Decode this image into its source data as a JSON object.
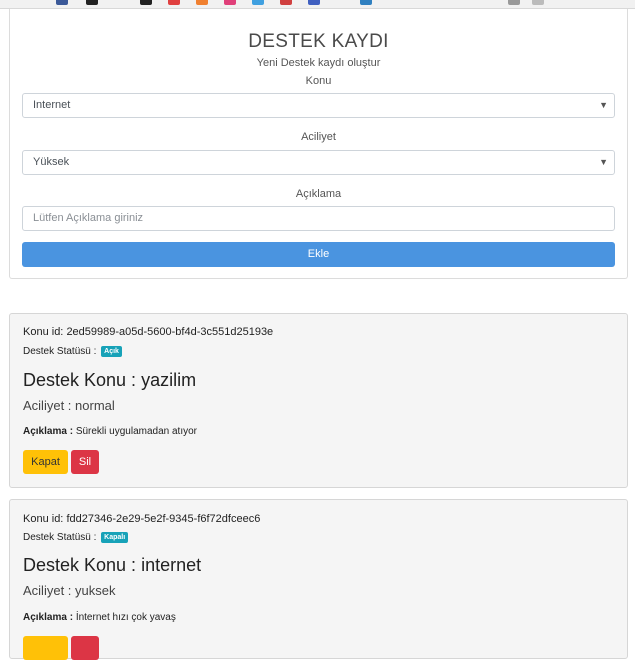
{
  "form": {
    "title": "DESTEK KAYDI",
    "subtitle": "Yeni Destek kaydı oluştur",
    "topic_label": "Konu",
    "topic_value": "Internet",
    "priority_label": "Aciliyet",
    "priority_value": "Yüksek",
    "description_label": "Açıklama",
    "description_placeholder": "Lütfen Açıklama giriniz",
    "add_button": "Ekle"
  },
  "tickets": [
    {
      "id_label": "Konu id:",
      "id": "2ed59989-a05d-5600-bf4d-3c551d25193e",
      "status_label": "Destek Statüsü :",
      "status": "Açık",
      "topic_label": "Destek Konu :",
      "topic": "yazilim",
      "priority_label": "Aciliyet :",
      "priority": "normal",
      "description_label": "Açıklama :",
      "description": "Sürekli uygulamadan atıyor",
      "close_button": "Kapat",
      "delete_button": "Sil"
    },
    {
      "id_label": "Konu id:",
      "id": "fdd27346-2e29-5e2f-9345-f6f72dfceec6",
      "status_label": "Destek Statüsü :",
      "status": "Kapalı",
      "topic_label": "Destek Konu :",
      "topic": "internet",
      "priority_label": "Aciliyet :",
      "priority": "yuksek",
      "description_label": "Açıklama :",
      "description": "İnternet hızı çok yavaş"
    }
  ],
  "colors": {
    "primary": "#4a94e0",
    "warning": "#ffc107",
    "danger": "#dc3545",
    "info": "#17a2b8"
  }
}
